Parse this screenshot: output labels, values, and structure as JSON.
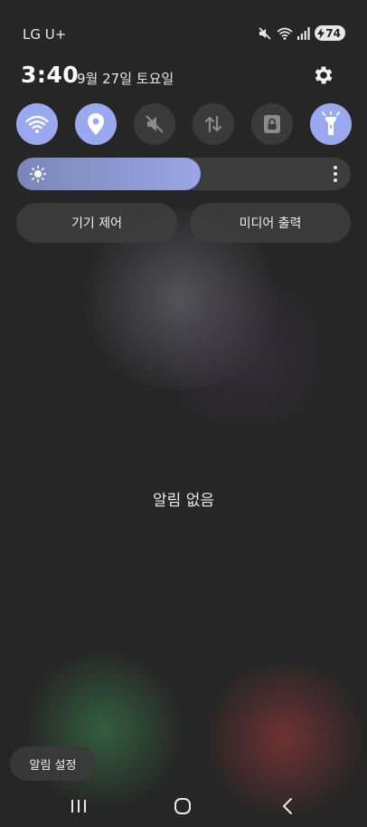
{
  "status_bar": {
    "carrier": "LG U+",
    "battery_level": "74",
    "icons": [
      "mute-icon",
      "wifi-icon",
      "signal-icon",
      "battery-charging-icon"
    ]
  },
  "header": {
    "time": "3:40",
    "date": "9월 27일 토요일",
    "settings_icon": "gear-icon"
  },
  "quick_settings": [
    {
      "name": "wifi",
      "icon": "wifi-icon",
      "active": true
    },
    {
      "name": "location",
      "icon": "location-icon",
      "active": true
    },
    {
      "name": "sound",
      "icon": "mute-icon",
      "active": false
    },
    {
      "name": "mobile-data",
      "icon": "data-transfer-icon",
      "active": false
    },
    {
      "name": "secure-folder",
      "icon": "lock-icon",
      "active": false
    },
    {
      "name": "flashlight",
      "icon": "flashlight-icon",
      "active": true
    }
  ],
  "brightness": {
    "level": 0.55,
    "icon": "sun-icon",
    "menu_icon": "more-vertical-icon"
  },
  "buttons": {
    "device_control": "기기 제어",
    "media_output": "미디어 출력"
  },
  "notifications": {
    "empty_text": "알림 없음",
    "settings_label": "알림 설정"
  },
  "nav": [
    "recent-apps-icon",
    "home-icon",
    "back-icon"
  ],
  "colors": {
    "accent": "#9aa8f0",
    "background": "#262626"
  }
}
